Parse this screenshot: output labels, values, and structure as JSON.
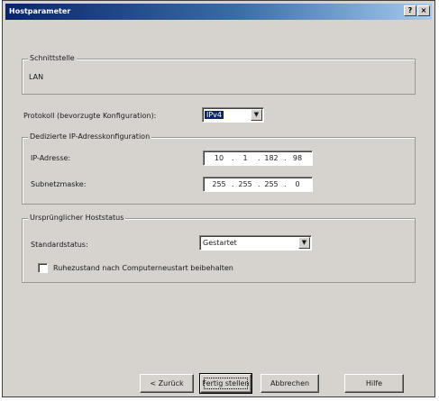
{
  "window": {
    "title": "Hostparameter",
    "help_glyph": "?",
    "close_glyph": "×"
  },
  "interface_group": {
    "legend": "Schnittstelle",
    "value": "LAN"
  },
  "protocol": {
    "label": "Protokoll (bevorzugte Konfiguration):",
    "value": "IPv4",
    "arrow": "▼"
  },
  "ip_group": {
    "legend": "Dedizierte IP-Adresskonfiguration",
    "ip_label": "IP-Adresse:",
    "ip_octets": [
      "10",
      "1",
      "182",
      "98"
    ],
    "mask_label": "Subnetzmaske:",
    "mask_octets": [
      "255",
      "255",
      "255",
      "0"
    ],
    "dot": "."
  },
  "host_group": {
    "legend": "Ursprünglicher Hoststatus",
    "status_label": "Standardstatus:",
    "status_value": "Gestartet",
    "arrow": "▼",
    "checkbox_label": "Ruhezustand nach Computerneustart beibehalten",
    "checkbox_checked": false
  },
  "buttons": {
    "back": "< Zurück",
    "finish": "Fertig stellen",
    "cancel": "Abbrechen",
    "help": "Hilfe"
  }
}
